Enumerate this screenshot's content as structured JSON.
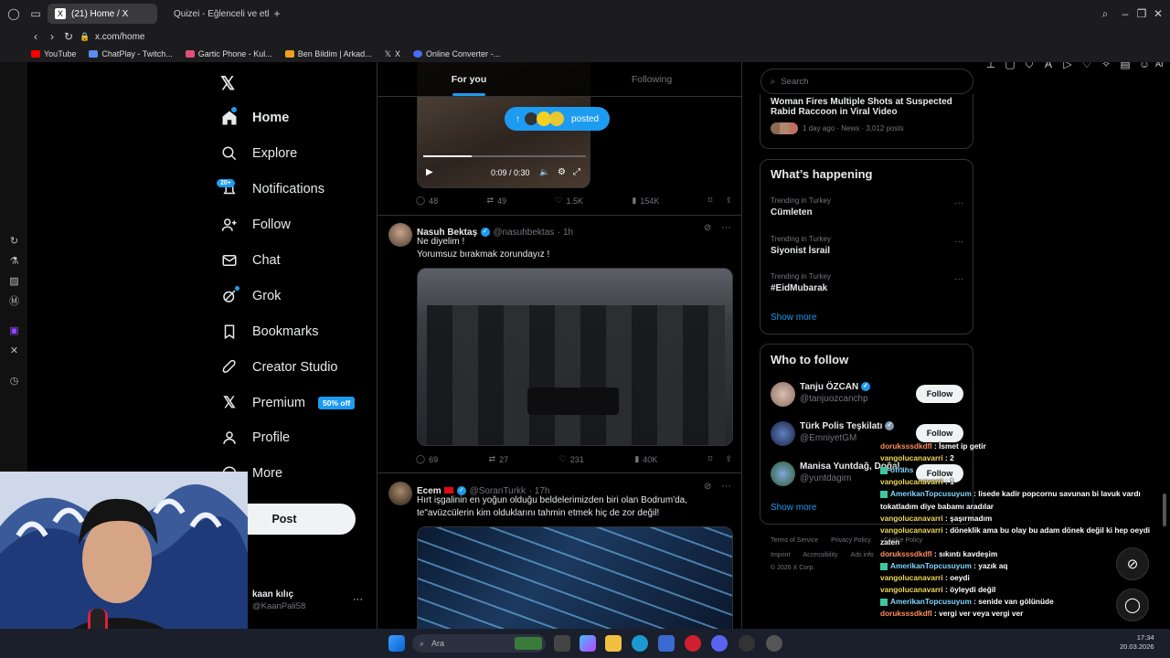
{
  "browser": {
    "tabs": [
      {
        "label": "(21) Home / X",
        "active": true
      },
      {
        "label": "Quizei - Eğlenceli ve etkile",
        "active": false
      }
    ],
    "url": "x.com/home",
    "bookmarks": [
      "YouTube",
      "ChatPlay - Twitch...",
      "Gartic Phone - Kul...",
      "Ben Bildim | Arkad...",
      "X",
      "Online Converter -..."
    ],
    "right_label": "AI"
  },
  "nav": {
    "items": [
      {
        "label": "Home",
        "icon": "home-icon"
      },
      {
        "label": "Explore",
        "icon": "search-icon"
      },
      {
        "label": "Notifications",
        "icon": "bell-icon"
      },
      {
        "label": "Follow",
        "icon": "add-person-icon"
      },
      {
        "label": "Chat",
        "icon": "mail-icon"
      },
      {
        "label": "Grok",
        "icon": "grok-icon"
      },
      {
        "label": "Bookmarks",
        "icon": "bookmark-icon"
      },
      {
        "label": "Creator Studio",
        "icon": "rocket-icon"
      },
      {
        "label": "Premium",
        "icon": "x-icon"
      },
      {
        "label": "Profile",
        "icon": "person-icon"
      },
      {
        "label": "More",
        "icon": "more-circle-icon"
      }
    ],
    "notif_badge": "20+",
    "premium_badge": "50% off",
    "post_label": "Post",
    "account": {
      "name": "kaan kılıç",
      "handle": "@KaanPali58"
    }
  },
  "feed": {
    "tabs": [
      "For you",
      "Following"
    ],
    "posted_pill": "posted",
    "video_time": "0:09 / 0:30",
    "tweets": [
      {
        "stats": {
          "replies": "48",
          "reposts": "49",
          "likes": "1.5K",
          "views": "154K"
        }
      },
      {
        "name": "Nasuh Bektaş",
        "handle": "@nasuhbektas",
        "time": "· 1h",
        "lines": [
          "Ne diyelim !",
          "Yorumsuz bırakmak zorundayız !"
        ],
        "stats": {
          "replies": "69",
          "reposts": "27",
          "likes": "231",
          "views": "40K"
        }
      },
      {
        "name": "Ecem",
        "handle": "@SoranTurkk",
        "time": "· 17h",
        "lines": [
          "Hırt işgalinin en yoğun olduğu beldelerimizden biri olan Bodrum'da,",
          "te\"avüzcülerin kim olduklarını tahmin etmek hiç de zor değil!"
        ]
      }
    ]
  },
  "right": {
    "search_placeholder": "Search",
    "top_news": {
      "title_l1": "Woman Fires Multiple Shots at Suspected",
      "title_l2": "Rabid Raccoon in Viral Video",
      "meta": "1 day ago · News · 3,012 posts"
    },
    "happening_title": "What’s happening",
    "trends": [
      {
        "context": "Trending in Turkey",
        "name": "Cümleten"
      },
      {
        "context": "Trending in Turkey",
        "name": "Siyonist İsrail"
      },
      {
        "context": "Trending in Turkey",
        "name": "#EidMubarak"
      }
    ],
    "show_more": "Show more",
    "who_title": "Who to follow",
    "follow": [
      {
        "name": "Tanju ÖZCAN",
        "handle": "@tanjuozcanchp",
        "button": "Follow"
      },
      {
        "name": "Türk Polis Teşkilatı",
        "handle": "@EmniyetGM",
        "button": "Follow"
      },
      {
        "name": "Manisa Yuntdağ, Doğal...",
        "handle": "@yuntdagim",
        "button": "Follow"
      }
    ],
    "footer_l1": [
      "Terms of Service",
      "Privacy Policy",
      "Cookie Policy"
    ],
    "footer_l2": [
      "Imprint",
      "Accessibility",
      "Ads info",
      "More ···"
    ],
    "copyright": "© 2026 X Corp."
  },
  "chat": [
    {
      "user": "doruksssdkdfl",
      "msg": " : İsmet ip getir"
    },
    {
      "user": "vangolucanavarri",
      "msg": " : 2"
    },
    {
      "user": "ofrans",
      "msg": ""
    },
    {
      "user": "vangolucanavarri",
      "msg": " : 1"
    },
    {
      "user": "AmerikanTopcusuyum",
      "msg": " : lisede kadir popcornu savunan bi lavuk vardı"
    },
    {
      "user": "",
      "msg": "tokatladım diye babamı aradılar"
    },
    {
      "user": "vangolucanavarri",
      "msg": " : şaşırmadım"
    },
    {
      "user": "vangolucanavarri",
      "msg": " : döneklik ama bu olay bu adam dönek değil ki hep oeydi"
    },
    {
      "user": "",
      "msg": "zaten"
    },
    {
      "user": "doruksssdkdfl",
      "msg": " : sıkıntı kavdeşim"
    },
    {
      "user": "AmerikanTopcusuyum",
      "msg": " : yazık aq"
    },
    {
      "user": "vangolucanavarri",
      "msg": " : oeydi"
    },
    {
      "user": "vangolucanavarri",
      "msg": " : öyleydi değil"
    },
    {
      "user": "AmerikanTopcusuyum",
      "msg": " : senide van gölünüde"
    },
    {
      "user": "doruksssdkdfl",
      "msg": " : vergi ver veya vergi ver"
    }
  ],
  "taskbar": {
    "search": "Ara",
    "time": "17:34",
    "date": "20.03.2026"
  }
}
